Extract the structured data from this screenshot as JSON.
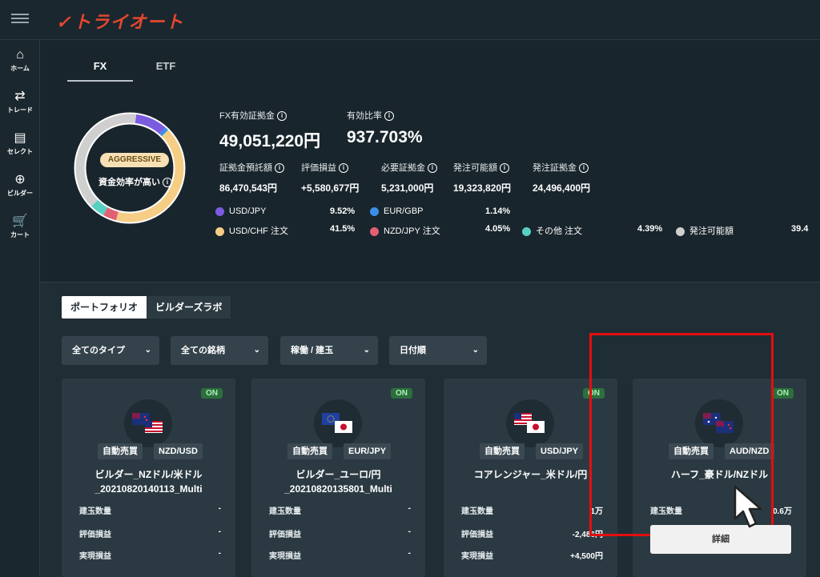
{
  "app": {
    "logo_text": "トライオート"
  },
  "sidebar": {
    "items": [
      {
        "label": "ホーム",
        "icon": "home-icon"
      },
      {
        "label": "トレード",
        "icon": "trade-arrows-icon"
      },
      {
        "label": "セレクト",
        "icon": "select-icon"
      },
      {
        "label": "ビルダー",
        "icon": "builder-plus-icon"
      },
      {
        "label": "カート",
        "icon": "cart-icon"
      }
    ]
  },
  "summary": {
    "tabs": [
      "FX",
      "ETF"
    ],
    "active_tab": "FX",
    "risk_badge": "AGGRESSIVE",
    "donut_caption": "資金効率が高い",
    "effective_margin_label": "FX有効証拠金",
    "effective_margin_value": "49,051,220円",
    "effective_ratio_label": "有効比率",
    "effective_ratio_value": "937.703%",
    "metrics": [
      {
        "label": "証拠金預託額",
        "value": "86,470,543円"
      },
      {
        "label": "評価損益",
        "value": "+5,580,677円"
      },
      {
        "label": "必要証拠金",
        "value": "5,231,000円"
      },
      {
        "label": "発注可能額",
        "value": "19,323,820円"
      },
      {
        "label": "発注証拠金",
        "value": "24,496,400円"
      }
    ],
    "legend": [
      {
        "name": "USD/JPY",
        "pct": "9.52%",
        "color": "#7b5ce0"
      },
      {
        "name": "EUR/GBP",
        "pct": "1.14%",
        "color": "#3b8fe8"
      },
      {
        "name": "USD/CHF 注文",
        "pct": "41.5%",
        "color": "#f5cd84"
      },
      {
        "name": "NZD/JPY 注文",
        "pct": "4.05%",
        "color": "#e35f72"
      },
      {
        "name": "その他 注文",
        "pct": "4.39%",
        "color": "#57cfc3"
      },
      {
        "name": "発注可能額",
        "pct": "39.4",
        "color": "#cfcfcf"
      }
    ]
  },
  "portfolio": {
    "tabs": [
      "ポートフォリオ",
      "ビルダーズラボ"
    ],
    "filters": [
      "全てのタイプ",
      "全ての銘柄",
      "稼働 / 建玉",
      "日付順"
    ],
    "stat_labels": [
      "建玉数量",
      "評価損益",
      "実現損益"
    ],
    "cards": [
      {
        "status": "ON",
        "type": "自動売買",
        "pair": "NZD/USD",
        "title1": "ビルダー_NZドル/米ドル",
        "title2": "_20210820140113_Multi",
        "stats": [
          "-",
          "-",
          "-"
        ]
      },
      {
        "status": "ON",
        "type": "自動売買",
        "pair": "EUR/JPY",
        "title1": "ビルダー_ユーロ/円",
        "title2": "_20210820135801_Multi",
        "stats": [
          "-",
          "-",
          "-"
        ]
      },
      {
        "status": "ON",
        "type": "自動売買",
        "pair": "USD/JPY",
        "title1": "コアレンジャー_米ドル/円",
        "title2": "",
        "stats": [
          "1万",
          "-2,486円",
          "+4,500円"
        ]
      },
      {
        "status": "ON",
        "type": "自動売買",
        "pair": "AUD/NZD",
        "title1": "ハーフ_豪ドル/NZドル",
        "title2": "",
        "stats": [
          "0.6万",
          "",
          ""
        ]
      }
    ],
    "detail_button": "詳細"
  },
  "colors": {
    "accent": "#e4472e",
    "highlight_border": "#e30e0e",
    "on_badge": "#2d6e3c"
  }
}
